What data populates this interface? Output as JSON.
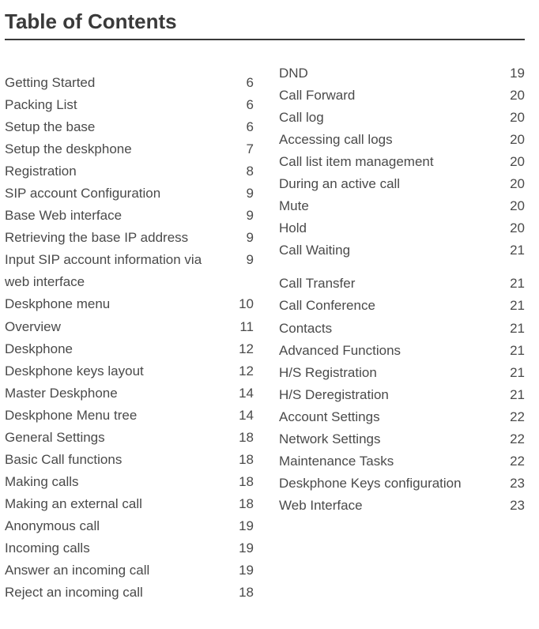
{
  "title": "Table of Contents",
  "left": [
    {
      "label": "Getting Started",
      "page": "6"
    },
    {
      "label": "Packing List",
      "page": "6"
    },
    {
      "label": "Setup the base",
      "page": "6"
    },
    {
      "label": "Setup the deskphone",
      "page": "7"
    },
    {
      "label": "Registration",
      "page": "8"
    },
    {
      "label": "SIP account Configuration",
      "page": "9"
    },
    {
      "label": "Base Web interface",
      "page": "9"
    },
    {
      "label": "Retrieving the base IP address",
      "page": "9"
    },
    {
      "label": "Input SIP account information via web interface",
      "page": "9"
    },
    {
      "label": "Deskphone menu",
      "page": "10"
    },
    {
      "label": "Overview",
      "page": "11"
    },
    {
      "label": "Deskphone",
      "page": "12"
    },
    {
      "label": "Deskphone keys layout",
      "page": "12"
    },
    {
      "label": "Master Deskphone",
      "page": "14"
    },
    {
      "label": "Deskphone Menu tree",
      "page": "14"
    },
    {
      "label": "General Settings",
      "page": "18"
    },
    {
      "label": "Basic Call functions",
      "page": "18"
    },
    {
      "label": "Making calls",
      "page": "18"
    },
    {
      "label": "Making an external call",
      "page": "18"
    },
    {
      "label": "Anonymous call",
      "page": "19"
    },
    {
      "label": "Incoming calls",
      "page": "19"
    },
    {
      "label": "Answer an incoming call",
      "page": "19"
    },
    {
      "label": "Reject an incoming call",
      "page": "18"
    }
  ],
  "right_top": [
    {
      "label": "DND",
      "page": "19"
    },
    {
      "label": "Call Forward",
      "page": "20"
    },
    {
      "label": "Call log",
      "page": "20"
    },
    {
      "label": "Accessing call logs",
      "page": "20"
    },
    {
      "label": "Call list item management",
      "page": "20"
    },
    {
      "label": "During an active call",
      "page": "20"
    },
    {
      "label": "Mute",
      "page": "20"
    },
    {
      "label": "Hold",
      "page": "20"
    },
    {
      "label": "Call Waiting",
      "page": "21"
    }
  ],
  "right_bottom": [
    {
      "label": "Call Transfer",
      "page": "21"
    },
    {
      "label": "Call Conference",
      "page": "21"
    },
    {
      "label": "Contacts",
      "page": "21"
    },
    {
      "label": "Advanced Functions",
      "page": "21"
    },
    {
      "label": "H/S Registration",
      "page": "21"
    },
    {
      "label": "H/S Deregistration",
      "page": "21"
    },
    {
      "label": "Account Settings",
      "page": "22"
    },
    {
      "label": "Network Settings",
      "page": "22"
    },
    {
      "label": "Maintenance Tasks",
      "page": "22"
    },
    {
      "label": "Deskphone Keys configuration",
      "page": "23"
    },
    {
      "label": "Web Interface",
      "page": "23"
    }
  ]
}
